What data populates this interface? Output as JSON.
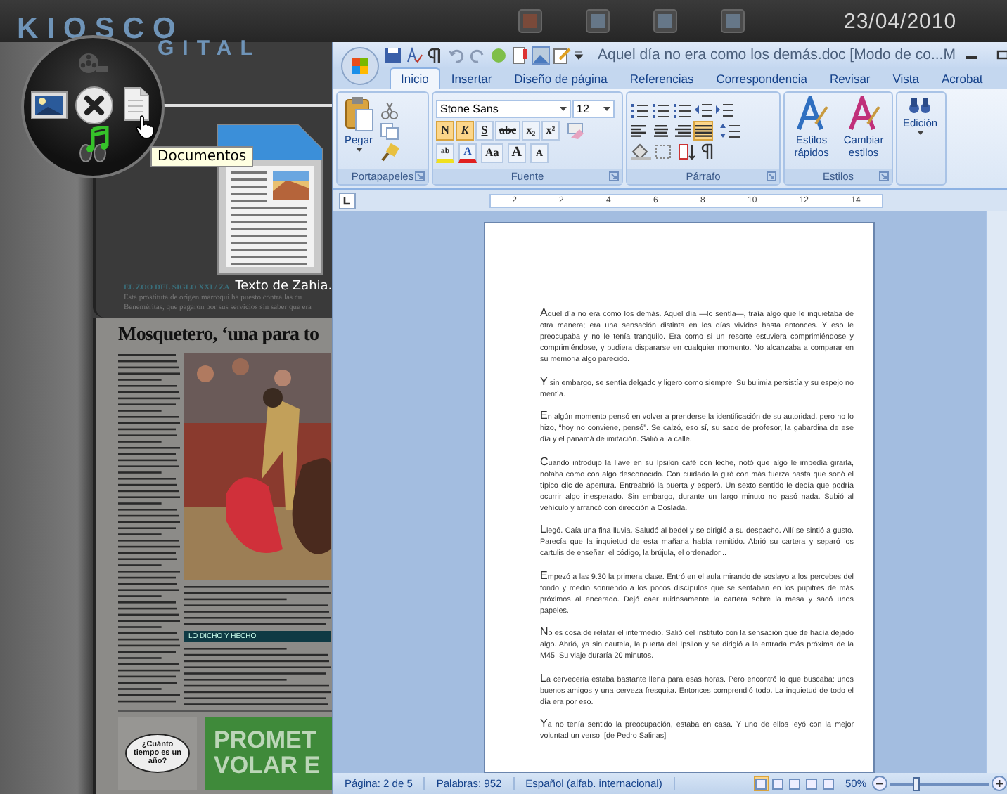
{
  "top_bar": {
    "date": "23/04/2010"
  },
  "logo": {
    "line_1": "KIOSCO",
    "line_2": "GITAL"
  },
  "circle_menu": {
    "tooltip": "Documentos"
  },
  "document_card": {
    "caption": "Texto de Zahia.",
    "section": "EL ZOO DEL SIGLO XXI / ZA",
    "lead_lines": [
      "Esta prostituta de origen marroquí ha puesto contra las cu",
      "Beneméritas, que pagaron por sus servicios sin saber que era"
    ]
  },
  "newspaper": {
    "headline": "Mosquetero, ‘una para to",
    "box_title": "LO DICHO Y HECHO",
    "cartoon_text": "¿Cuánto tiempo es un año?",
    "ad_lines": [
      "PROMET",
      "VOLAR E"
    ]
  },
  "word": {
    "title": "Aquel día no era como los demás.doc [Modo de co...M",
    "tabs": [
      {
        "label": "Inicio",
        "selected": true
      },
      {
        "label": "Insertar",
        "selected": false
      },
      {
        "label": "Diseño de página",
        "selected": false
      },
      {
        "label": "Referencias",
        "selected": false
      },
      {
        "label": "Correspondencia",
        "selected": false
      },
      {
        "label": "Revisar",
        "selected": false
      },
      {
        "label": "Vista",
        "selected": false
      },
      {
        "label": "Acrobat",
        "selected": false
      }
    ],
    "clipboard": {
      "paste": "Pegar",
      "label": "Portapapeles"
    },
    "font": {
      "name": "Stone Sans",
      "size": "12",
      "label": "Fuente",
      "format_buttons": [
        {
          "label": "N",
          "selected": true
        },
        {
          "label": "K",
          "selected": true
        },
        {
          "label": "S",
          "selected": false
        },
        {
          "label": "abc",
          "selected": false
        },
        {
          "label": "x₂",
          "selected": false
        },
        {
          "label": "x²",
          "selected": false
        }
      ],
      "color_buttons": [
        {
          "kind": "highlight",
          "label": "ab"
        },
        {
          "kind": "font-color",
          "label": "A"
        },
        {
          "kind": "case",
          "label": "Aa"
        },
        {
          "kind": "grow",
          "label": "A"
        },
        {
          "kind": "shrink",
          "label": "A"
        }
      ]
    },
    "paragraph": {
      "label": "Párrafo",
      "alignment": [
        {
          "selected": false
        },
        {
          "selected": false
        },
        {
          "selected": false
        },
        {
          "selected": true
        }
      ]
    },
    "styles": {
      "quick": "Estilos rápidos",
      "change": "Cambiar estilos",
      "label": "Estilos"
    },
    "editing": {
      "label": "Edición"
    },
    "ruler": [
      "2",
      "2",
      "4",
      "6",
      "8",
      "10",
      "12",
      "14"
    ],
    "paragraphs": [
      "Aquel día no era como los demás. Aquel día —lo sentía—, traía algo que le inquietaba de otra manera; era una sensación distinta en los días vividos hasta entonces. Y eso le preocupaba y no le tenía tranquilo. Era como si un resorte estuviera comprimiéndose y comprimiéndose, y pudiera dispararse en cualquier momento. No alcanzaba a comparar en su memoria algo parecido.",
      "Y sin embargo, se sentía delgado y ligero como siempre. Su bulimia persistía y su espejo no mentía.",
      "En algún momento pensó en volver a prenderse la identificación de su autoridad, pero no lo hizo, “hoy no conviene, pensó”. Se calzó, eso sí, su saco de profesor, la gabardina de ese día y el panamá de imitación. Salió a la calle.",
      "Cuando introdujo la llave en su Ipsilon café con leche, notó que algo le impedía girarla, notaba como con algo desconocido. Con cuidado la giró con más fuerza hasta que sonó el típico clic de apertura. Entreabrió la puerta y esperó. Un sexto sentido le decía que podría ocurrir algo inesperado. Sin embargo, durante un largo minuto no pasó nada. Subió al vehículo y arrancó con dirección a Coslada.",
      "Llegó. Caía una fina lluvia. Saludó al bedel y se dirigió a su despacho. Allí se sintió a gusto. Parecía que la inquietud de esta mañana había remitido. Abrió su cartera y separó los cartulis de enseñar: el código, la brújula, el ordenador...",
      "Empezó a las 9.30 la primera clase. Entró en el aula mirando de soslayo a los percebes del fondo y medio sonriendo a los pocos discípulos que se sentaban en los pupitres de más próximos al encerado. Dejó caer ruidosamente la cartera sobre la mesa y sacó unos papeles.",
      "No es cosa de relatar el intermedio. Salió del instituto con la sensación que de hacía dejado algo. Abrió, ya sin cautela, la puerta del Ipsilon y se dirigió a la entrada más próxima de la M45. Su viaje duraría 20 minutos.",
      "La cervecería estaba bastante llena para esas horas. Pero encontró lo que buscaba: unos buenos amigos y una cerveza fresquita. Entonces comprendió todo. La inquietud de todo el día era por eso.",
      "Ya no tenía sentido la preocupación, estaba en casa. Y uno de ellos leyó con la mejor voluntad un verso. [de Pedro Salinas]"
    ],
    "status": {
      "page": "Página: 2 de 5",
      "words": "Palabras: 952",
      "language": "Español (alfab. internacional)",
      "zoom": "50%",
      "zoom_slider": {
        "level": 0.25
      },
      "views": [
        {
          "selected": true
        },
        {
          "selected": false
        },
        {
          "selected": false
        },
        {
          "selected": false
        },
        {
          "selected": false
        }
      ]
    }
  }
}
